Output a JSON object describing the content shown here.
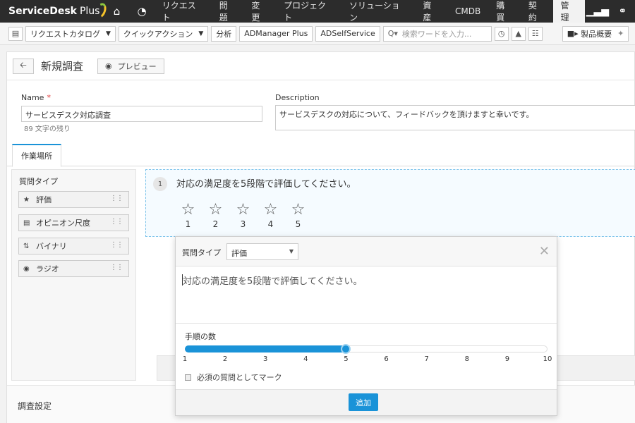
{
  "topnav": {
    "logo": "ServiceDesk",
    "logo_plus": "Plus",
    "items": [
      {
        "label": "リクエスト",
        "active": false
      },
      {
        "label": "問題",
        "active": false
      },
      {
        "label": "変更",
        "active": false
      },
      {
        "label": "プロジェクト",
        "active": false
      },
      {
        "label": "ソリューション",
        "active": false
      },
      {
        "label": "資産",
        "active": false
      },
      {
        "label": "CMDB",
        "active": false
      },
      {
        "label": "購買",
        "active": false
      },
      {
        "label": "契約",
        "active": false
      },
      {
        "label": "管理",
        "active": true
      }
    ]
  },
  "toolbar": {
    "request_catalog": "リクエストカタログ",
    "quick_action": "クイックアクション",
    "analytics": "分析",
    "admanager": "ADManager Plus",
    "adselfservice": "ADSelfService",
    "search_placeholder": "検索ワードを入力...",
    "product_overview": "製品概要"
  },
  "header": {
    "title": "新規調査",
    "preview": "プレビュー"
  },
  "form": {
    "name_label": "Name",
    "name_value": "サービスデスク対応調査",
    "name_remaining": "89 文字の残り",
    "description_label": "Description",
    "description_value": "サービスデスクの対応について、フィードバックを頂けますと幸いです。"
  },
  "tabs": {
    "workspace": "作業場所"
  },
  "question_types": {
    "title": "質問タイプ",
    "items": [
      {
        "label": "評価",
        "icon": "star-icon"
      },
      {
        "label": "オピニオン尺度",
        "icon": "scale-icon"
      },
      {
        "label": "バイナリ",
        "icon": "binary-icon"
      },
      {
        "label": "ラジオ",
        "icon": "radio-icon"
      }
    ]
  },
  "question": {
    "number": "1",
    "text": "対応の満足度を5段階で評価してください。",
    "stars": [
      "1",
      "2",
      "3",
      "4",
      "5"
    ]
  },
  "settings": {
    "title": "調査設定"
  },
  "popup": {
    "question_type_label": "質問タイプ",
    "question_type_value": "評価",
    "question_text": "対応の満足度を5段階で評価してください。",
    "steps_label": "手順の数",
    "steps_value": 5,
    "steps_min": 1,
    "steps_max": 10,
    "ticks": [
      "1",
      "2",
      "3",
      "4",
      "5",
      "6",
      "7",
      "8",
      "9",
      "10"
    ],
    "mandatory_label": "必須の質問としてマーク",
    "mandatory_checked": false,
    "add_button": "追加"
  },
  "colors": {
    "accent": "#1a93d8",
    "topnav_bg": "#2c2c2c"
  }
}
